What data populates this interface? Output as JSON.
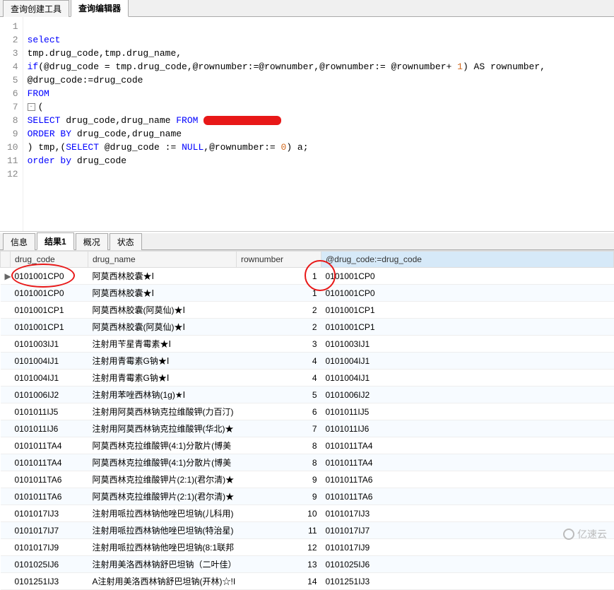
{
  "top_tabs": {
    "tab1": "查询创建工具",
    "tab2": "查询编辑器"
  },
  "editor": {
    "lines": {
      "l1": "select",
      "l2a": "tmp.drug_code,tmp.drug_name,",
      "l3_if": "if",
      "l3_body": "(@drug_code = tmp.drug_code,@rownumber:=@rownumber,@rownumber:= @rownumber+ ",
      "l3_one": "1",
      "l3_as": ") AS rownumber,",
      "l4": "@drug_code:=drug_code",
      "l5": "FROM",
      "l6": "(",
      "l7a": "SELECT",
      "l7b": " drug_code,drug_name ",
      "l7c": "FROM",
      "l8a": "ORDER BY",
      "l8b": " drug_code,drug_name",
      "l9a": ") tmp,(",
      "l9_sel": "SELECT",
      "l9b": " @drug_code := ",
      "l9_null": "NULL",
      "l9c": ",@rownumber:= ",
      "l9_zero": "0",
      "l9d": ") a;",
      "l10a": "order by",
      "l10b": " drug_code"
    },
    "gutter": [
      "1",
      "2",
      "3",
      "4",
      "5",
      "6",
      "7",
      "8",
      "9",
      "10",
      "11",
      "12"
    ]
  },
  "bottom_tabs": {
    "t1": "信息",
    "t2": "结果1",
    "t3": "概况",
    "t4": "状态"
  },
  "columns": {
    "c1": "drug_code",
    "c2": "drug_name",
    "c3": "rownumber",
    "c4": "@drug_code:=drug_code"
  },
  "rows": [
    {
      "ptr": "▶",
      "dc": "0101001CP0",
      "dn": "阿莫西林胶囊★Ⅰ",
      "rn": "1",
      "dd": "0101001CP0"
    },
    {
      "ptr": "",
      "dc": "0101001CP0",
      "dn": "阿莫西林胶囊★Ⅰ",
      "rn": "1",
      "dd": "0101001CP0"
    },
    {
      "ptr": "",
      "dc": "0101001CP1",
      "dn": "阿莫西林胶囊(阿莫仙)★Ⅰ",
      "rn": "2",
      "dd": "0101001CP1"
    },
    {
      "ptr": "",
      "dc": "0101001CP1",
      "dn": "阿莫西林胶囊(阿莫仙)★Ⅰ",
      "rn": "2",
      "dd": "0101001CP1"
    },
    {
      "ptr": "",
      "dc": "0101003IJ1",
      "dn": "注射用苄星青霉素★Ⅰ",
      "rn": "3",
      "dd": "0101003IJ1"
    },
    {
      "ptr": "",
      "dc": "0101004IJ1",
      "dn": "注射用青霉素G钠★Ⅰ",
      "rn": "4",
      "dd": "0101004IJ1"
    },
    {
      "ptr": "",
      "dc": "0101004IJ1",
      "dn": "注射用青霉素G钠★Ⅰ",
      "rn": "4",
      "dd": "0101004IJ1"
    },
    {
      "ptr": "",
      "dc": "0101006IJ2",
      "dn": "注射用苯唑西林钠(1g)★Ⅰ",
      "rn": "5",
      "dd": "0101006IJ2"
    },
    {
      "ptr": "",
      "dc": "0101011IJ5",
      "dn": "注射用阿莫西林钠克拉维酸钾(力百汀)",
      "rn": "6",
      "dd": "0101011IJ5"
    },
    {
      "ptr": "",
      "dc": "0101011IJ6",
      "dn": "注射用阿莫西林钠克拉维酸钾(华北)★",
      "rn": "7",
      "dd": "0101011IJ6"
    },
    {
      "ptr": "",
      "dc": "0101011TA4",
      "dn": "阿莫西林克拉维酸钾(4:1)分散片(博美",
      "rn": "8",
      "dd": "0101011TA4"
    },
    {
      "ptr": "",
      "dc": "0101011TA4",
      "dn": "阿莫西林克拉维酸钾(4:1)分散片(博美",
      "rn": "8",
      "dd": "0101011TA4"
    },
    {
      "ptr": "",
      "dc": "0101011TA6",
      "dn": "阿莫西林克拉维酸钾片(2:1)(君尔清)★",
      "rn": "9",
      "dd": "0101011TA6"
    },
    {
      "ptr": "",
      "dc": "0101011TA6",
      "dn": "阿莫西林克拉维酸钾片(2:1)(君尔清)★",
      "rn": "9",
      "dd": "0101011TA6"
    },
    {
      "ptr": "",
      "dc": "0101017IJ3",
      "dn": "注射用哌拉西林钠他唑巴坦钠(儿科用)",
      "rn": "10",
      "dd": "0101017IJ3"
    },
    {
      "ptr": "",
      "dc": "0101017IJ7",
      "dn": "注射用哌拉西林钠他唑巴坦钠(特治星)",
      "rn": "11",
      "dd": "0101017IJ7"
    },
    {
      "ptr": "",
      "dc": "0101017IJ9",
      "dn": "注射用哌拉西林钠他唑巴坦钠(8:1联邦",
      "rn": "12",
      "dd": "0101017IJ9"
    },
    {
      "ptr": "",
      "dc": "0101025IJ6",
      "dn": "注射用美洛西林钠舒巴坦钠（二叶佳）☆",
      "rn": "13",
      "dd": "0101025IJ6"
    },
    {
      "ptr": "",
      "dc": "0101251IJ3",
      "dn": "A注射用美洛西林钠舒巴坦钠(开林)☆!I",
      "rn": "14",
      "dd": "0101251IJ3"
    }
  ],
  "watermark": "亿速云"
}
